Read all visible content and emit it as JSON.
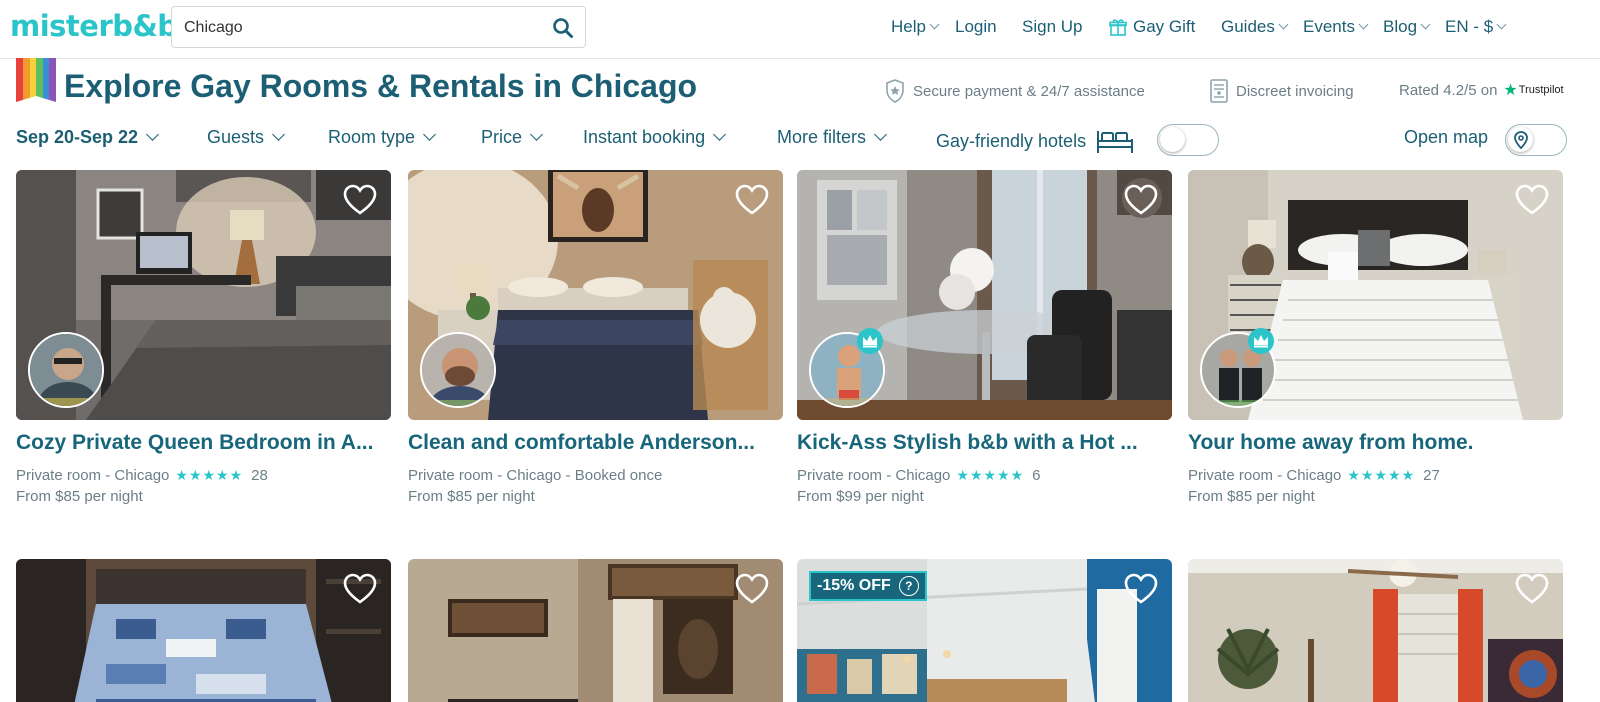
{
  "header": {
    "logo": "misterb&b",
    "search_value": "Chicago",
    "nav": [
      {
        "label": "Help",
        "dropdown": true
      },
      {
        "label": "Login",
        "dropdown": false
      },
      {
        "label": "Sign Up",
        "dropdown": false
      },
      {
        "label": "Gay Gift",
        "dropdown": false
      },
      {
        "label": "Guides",
        "dropdown": true
      },
      {
        "label": "Events",
        "dropdown": true
      },
      {
        "label": "Blog",
        "dropdown": true
      },
      {
        "label": "EN - $",
        "dropdown": true
      }
    ]
  },
  "page": {
    "title": "Explore Gay Rooms & Rentals in Chicago",
    "secure": "Secure payment & 24/7 assistance",
    "discreet": "Discreet invoicing",
    "rating": "Rated 4.2/5 on",
    "trustpilot": "Trustpilot"
  },
  "filters": {
    "dates": "Sep 20-Sep 22",
    "guests": "Guests",
    "room_type": "Room type",
    "price": "Price",
    "instant": "Instant booking",
    "more": "More filters",
    "hotels": "Gay-friendly hotels",
    "open_map": "Open map"
  },
  "listings": [
    {
      "title": "Cozy Private Queen Bedroom in A...",
      "type": "Private room - Chicago",
      "stars": "★★★★★",
      "reviews": "28",
      "price": "From $85 per night",
      "host_badge": false
    },
    {
      "title": "Clean and comfortable Anderson...",
      "type": "Private room - Chicago - Booked once",
      "stars": "",
      "reviews": "",
      "price": "From $85 per night",
      "host_badge": false
    },
    {
      "title": "Kick-Ass Stylish b&b with a Hot ...",
      "type": "Private room - Chicago",
      "stars": "★★★★★",
      "reviews": "6",
      "price": "From $99 per night",
      "host_badge": true
    },
    {
      "title": "Your home away from home.",
      "type": "Private room - Chicago",
      "stars": "★★★★★",
      "reviews": "27",
      "price": "From $85 per night",
      "host_badge": true
    }
  ],
  "second_row": {
    "discount": "-15% OFF",
    "discount_help": "?"
  },
  "colors": {
    "brand": "#2bc4c9",
    "title": "#1c5f74",
    "muted": "#6b7f86",
    "trustpilot_star": "#00b67a"
  }
}
